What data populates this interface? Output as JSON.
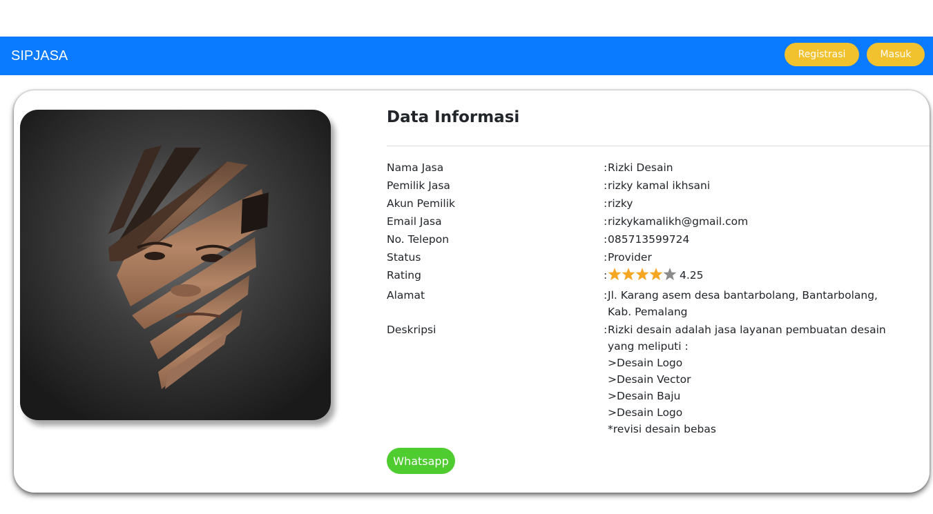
{
  "navbar": {
    "brand": "SIPJASA",
    "register_label": "Registrasi",
    "login_label": "Masuk",
    "background_color": "#0a7bff",
    "button_color": "#f2c12e"
  },
  "profile": {
    "photo_icon": "profile-photo",
    "title": "Data Informasi",
    "colon": ":",
    "fields": [
      {
        "label": "Nama Jasa",
        "value": "Rizki Desain"
      },
      {
        "label": "Pemilik Jasa",
        "value": "rizky kamal ikhsani"
      },
      {
        "label": "Akun Pemilik",
        "value": "rizky"
      },
      {
        "label": "Email Jasa",
        "value": "rizkykamalikh@gmail.com"
      },
      {
        "label": "No. Telepon",
        "value": "085713599724"
      },
      {
        "label": "Status",
        "value": "Provider"
      }
    ],
    "rating": {
      "label": "Rating",
      "value": "4.25",
      "stars_filled": 4,
      "stars_total": 5,
      "star_color": "#f5a623",
      "star_empty_color": "#8a8a8a"
    },
    "address": {
      "label": "Alamat",
      "value": "Jl. Karang asem desa bantarbolang, Bantarbolang, Kab. Pemalang"
    },
    "description": {
      "label": "Deskripsi",
      "value": "Rizki desain adalah jasa layanan pembuatan desain yang meliputi :\n>Desain Logo\n>Desain Vector\n>Desain Baju\n>Desain Logo\n*revisi desain bebas"
    },
    "whatsapp_label": "Whatsapp",
    "whatsapp_color": "#4fcc2f"
  }
}
